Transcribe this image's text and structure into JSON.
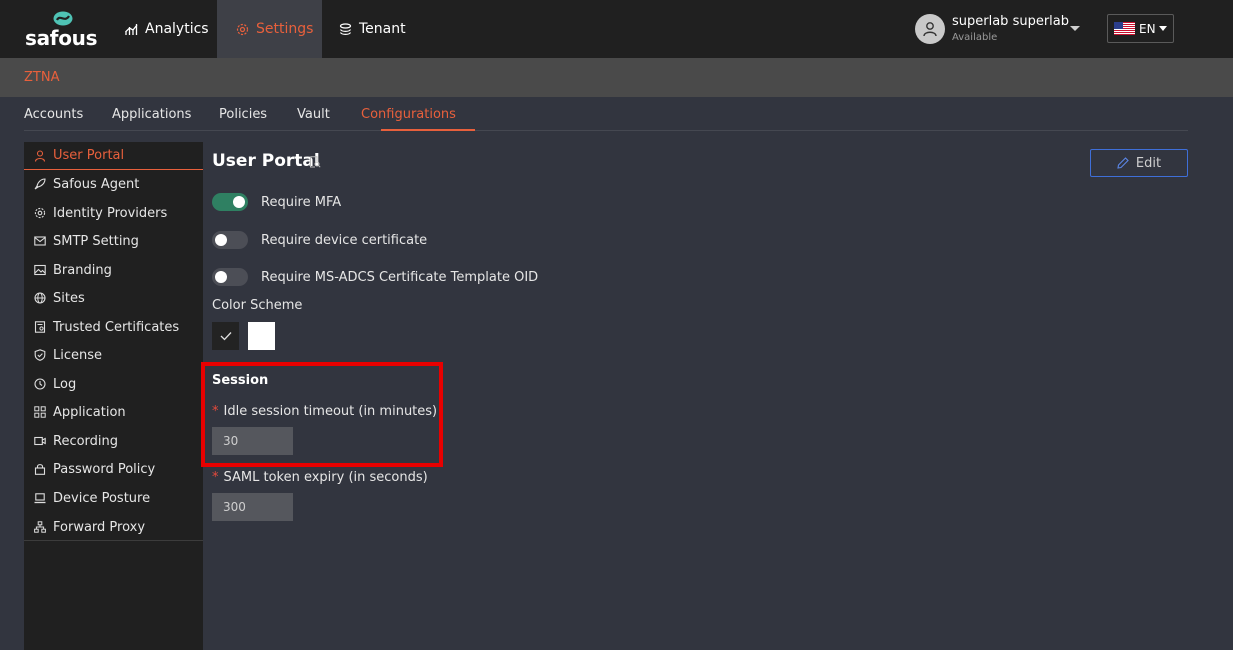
{
  "brand": {
    "logo_text": "safous",
    "accent_color": "#e8603c"
  },
  "topnav": {
    "items": [
      {
        "label": "Analytics",
        "icon": "bar-chart-icon"
      },
      {
        "label": "Settings",
        "icon": "gear-icon"
      },
      {
        "label": "Tenant",
        "icon": "tenant-icon"
      }
    ],
    "active": "Settings"
  },
  "user": {
    "name": "superlab superlab",
    "status": "Available"
  },
  "language": {
    "code": "EN",
    "flag": "us-flag-icon"
  },
  "breadcrumb": {
    "label": "ZTNA"
  },
  "tabs": {
    "items": [
      "Accounts",
      "Applications",
      "Policies",
      "Vault",
      "Configurations"
    ],
    "active": "Configurations"
  },
  "sidebar": {
    "active": "User Portal",
    "items": [
      {
        "label": "User Portal",
        "icon": "user-icon"
      },
      {
        "label": "Safous Agent",
        "icon": "rocket-icon"
      },
      {
        "label": "Identity Providers",
        "icon": "gear-icon"
      },
      {
        "label": "SMTP Setting",
        "icon": "mail-icon"
      },
      {
        "label": "Branding",
        "icon": "image-icon"
      },
      {
        "label": "Sites",
        "icon": "globe-icon"
      },
      {
        "label": "Trusted Certificates",
        "icon": "certificate-icon"
      },
      {
        "label": "License",
        "icon": "shield-icon"
      },
      {
        "label": "Log",
        "icon": "clock-icon"
      },
      {
        "label": "Application",
        "icon": "grid-icon"
      },
      {
        "label": "Recording",
        "icon": "video-icon"
      },
      {
        "label": "Password Policy",
        "icon": "lock-icon"
      },
      {
        "label": "Device Posture",
        "icon": "laptop-icon"
      },
      {
        "label": "Forward Proxy",
        "icon": "network-icon"
      }
    ]
  },
  "main": {
    "title": "User Portal",
    "edit_label": "Edit",
    "toggles": [
      {
        "label": "Require MFA",
        "on": true
      },
      {
        "label": "Require device certificate",
        "on": false
      },
      {
        "label": "Require MS-ADCS Certificate Template OID",
        "on": false
      }
    ],
    "color_scheme": {
      "label": "Color Scheme",
      "options": [
        "dark",
        "light"
      ],
      "selected": "dark"
    },
    "session": {
      "title": "Session",
      "required_marker": "*",
      "idle_timeout": {
        "label": "Idle session timeout (in minutes)",
        "value": "30"
      },
      "saml_expiry": {
        "label": "SAML token expiry (in seconds)",
        "value": "300"
      }
    }
  }
}
